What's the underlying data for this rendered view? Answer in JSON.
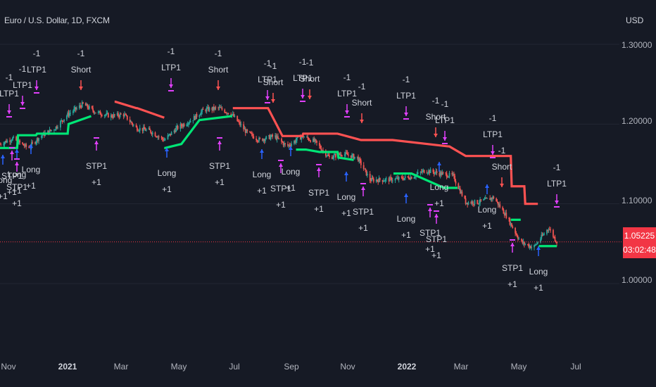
{
  "header": {
    "symbol_title": "Euro / U.S. Dollar, 1D, FXCM",
    "currency": "USD"
  },
  "y_axis": {
    "ticks": [
      "1.30000",
      "1.20000",
      "1.10000",
      "1.00000"
    ],
    "range": [
      0.95,
      1.32
    ]
  },
  "x_axis": {
    "ticks": [
      {
        "label": "Nov",
        "bold": false
      },
      {
        "label": "2021",
        "bold": true
      },
      {
        "label": "Mar",
        "bold": false
      },
      {
        "label": "May",
        "bold": false
      },
      {
        "label": "Jul",
        "bold": false
      },
      {
        "label": "Sep",
        "bold": false
      },
      {
        "label": "Nov",
        "bold": false
      },
      {
        "label": "2022",
        "bold": true
      },
      {
        "label": "Mar",
        "bold": false
      },
      {
        "label": "May",
        "bold": false
      },
      {
        "label": "Jul",
        "bold": false
      }
    ]
  },
  "last_price": {
    "value": "1.05225",
    "countdown": "03:02:48",
    "color": "#f23645"
  },
  "colors": {
    "up": "#26a69a",
    "down": "#ef5350",
    "stop_long": "#00e676",
    "stop_short": "#ff5252",
    "long_arrow": "#2962ff",
    "short_arrow": "#ff5252",
    "tp_marker": "#e040fb"
  },
  "chart_data": {
    "type": "line",
    "title": "Euro / U.S. Dollar, 1D, FXCM",
    "ylabel": "USD",
    "ylim": [
      0.95,
      1.32
    ],
    "grid": true,
    "series": [
      {
        "name": "",
        "description": "EURUSD close",
        "x": [
          "2020-10-01",
          "2020-10-15",
          "2020-11-01",
          "2020-11-15",
          "2020-12-01",
          "2020-12-15",
          "2021-01-01",
          "2021-01-15",
          "2021-02-01",
          "2021-02-15",
          "2021-03-01",
          "2021-03-15",
          "2021-04-01",
          "2021-04-15",
          "2021-05-01",
          "2021-05-15",
          "2021-06-01",
          "2021-06-15",
          "2021-07-01",
          "2021-07-15",
          "2021-08-01",
          "2021-08-15",
          "2021-09-01",
          "2021-09-15",
          "2021-10-01",
          "2021-10-15",
          "2021-11-01",
          "2021-11-15",
          "2021-12-01",
          "2021-12-15",
          "2022-01-01",
          "2022-01-15",
          "2022-02-01",
          "2022-02-15",
          "2022-03-01",
          "2022-03-15",
          "2022-04-01",
          "2022-04-15",
          "2022-05-01",
          "2022-05-15",
          "2022-06-01",
          "2022-06-10"
        ],
        "values": [
          1.175,
          1.182,
          1.17,
          1.185,
          1.195,
          1.212,
          1.225,
          1.215,
          1.21,
          1.212,
          1.195,
          1.192,
          1.18,
          1.195,
          1.205,
          1.218,
          1.22,
          1.212,
          1.19,
          1.18,
          1.185,
          1.172,
          1.185,
          1.178,
          1.158,
          1.163,
          1.158,
          1.13,
          1.13,
          1.131,
          1.134,
          1.142,
          1.138,
          1.135,
          1.102,
          1.102,
          1.108,
          1.085,
          1.052,
          1.045,
          1.07,
          1.052
        ]
      },
      {
        "name": "",
        "description": "Long stop",
        "x": [
          "2020-10-01",
          "2020-10-20",
          "2020-10-21",
          "2020-11-10",
          "2020-11-11",
          "2020-12-15",
          "2020-12-16",
          "2021-01-10",
          "2021-03-20",
          "2021-04-01",
          "2021-04-02",
          "2021-04-20",
          "2021-05-10",
          "2021-06-15",
          "2021-08-10",
          "2021-08-25",
          "2021-09-05",
          "2021-09-20",
          "2021-10-10",
          "2021-10-11",
          "2021-10-28",
          "2021-12-10",
          "2021-12-11",
          "2021-12-31",
          "2022-02-05",
          "2022-02-20",
          "2022-04-15",
          "2022-04-20",
          "2022-05-01",
          "2022-05-20",
          "2022-05-21",
          "2022-06-10"
        ],
        "values": [
          1.17,
          1.17,
          1.186,
          1.186,
          1.188,
          1.188,
          1.2,
          1.21,
          null,
          1.17,
          1.17,
          1.175,
          1.205,
          1.21,
          null,
          1.168,
          1.168,
          1.165,
          1.165,
          1.158,
          1.155,
          null,
          1.138,
          1.138,
          1.12,
          1.12,
          null,
          1.08,
          1.08,
          null,
          1.047,
          1.047
        ]
      },
      {
        "name": "",
        "description": "Short stop",
        "x": [
          "2021-01-10",
          "2021-02-05",
          "2021-02-06",
          "2021-03-01",
          "2021-03-02",
          "2021-04-01",
          "2021-06-15",
          "2021-06-16",
          "2021-07-25",
          "2021-08-10",
          "2021-09-01",
          "2021-09-02",
          "2021-10-10",
          "2021-11-05",
          "2021-11-06",
          "2021-12-10",
          "2022-02-10",
          "2022-02-11",
          "2022-03-01",
          "2022-03-02",
          "2022-04-20",
          "2022-04-21",
          "2022-05-05",
          "2022-05-06",
          "2022-05-20"
        ],
        "values": [
          null,
          1.228,
          1.228,
          1.22,
          1.22,
          1.208,
          null,
          1.22,
          1.22,
          1.185,
          1.185,
          1.188,
          1.188,
          1.18,
          1.18,
          1.18,
          1.172,
          1.172,
          1.16,
          1.16,
          1.16,
          1.122,
          1.122,
          1.1,
          1.1
        ]
      }
    ],
    "signals": [
      {
        "type": "long",
        "label": "Long",
        "qty": "+1"
      },
      {
        "type": "short",
        "label": "Short",
        "qty": "-1"
      },
      {
        "type": "ltp",
        "label": "LTP1",
        "qty": "-1"
      },
      {
        "type": "stp",
        "label": "STP1",
        "qty": "+1"
      }
    ]
  }
}
